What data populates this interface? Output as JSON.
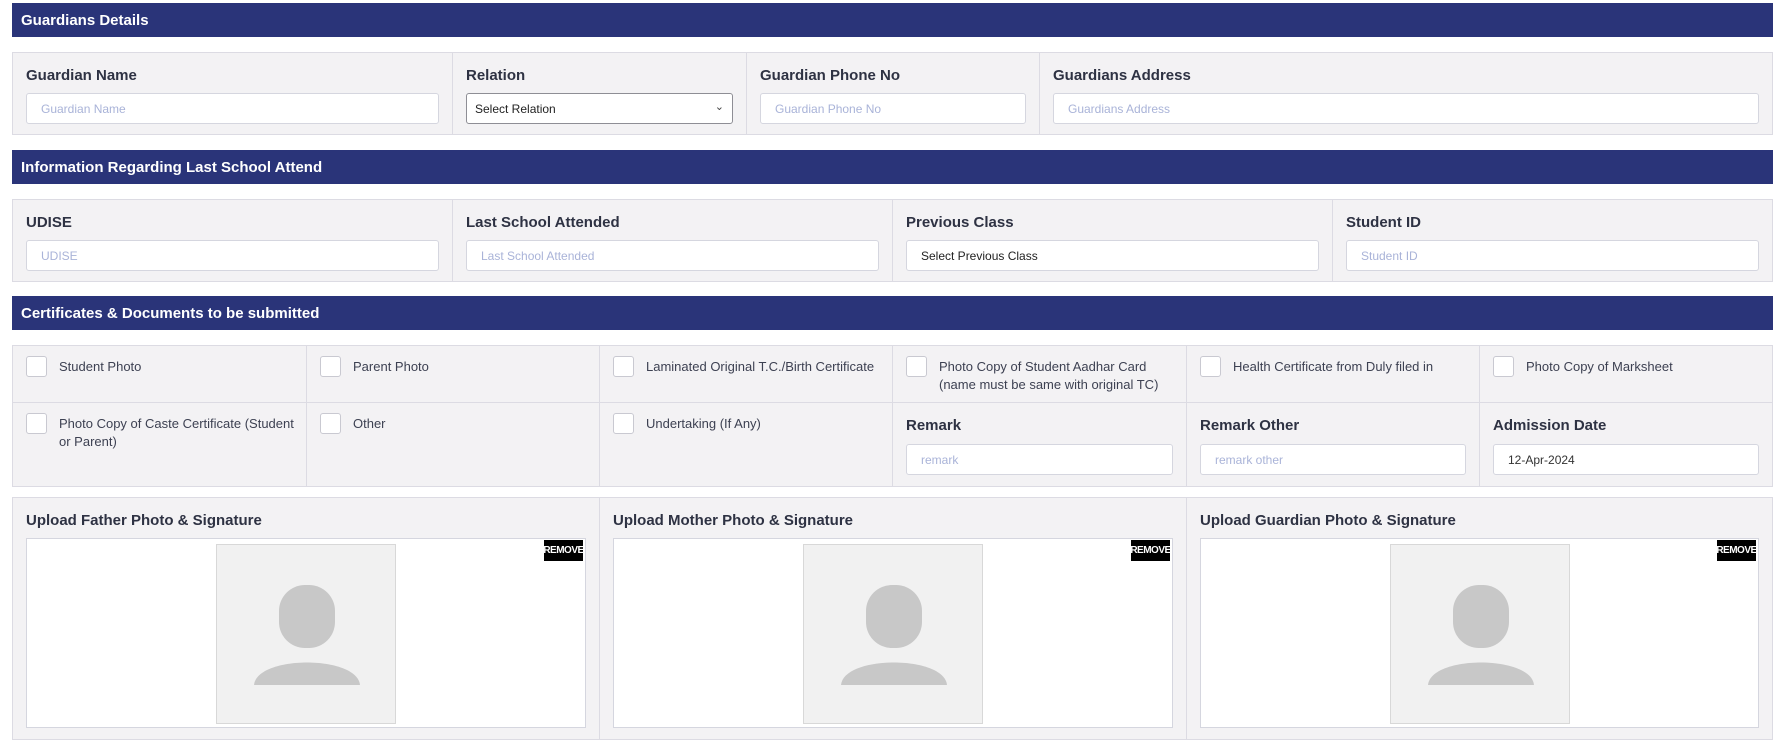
{
  "guardians": {
    "header": "Guardians Details",
    "name_label": "Guardian Name",
    "name_placeholder": "Guardian Name",
    "relation_label": "Relation",
    "relation_value": "Select Relation",
    "phone_label": "Guardian Phone No",
    "phone_placeholder": "Guardian Phone No",
    "address_label": "Guardians Address",
    "address_placeholder": "Guardians Address"
  },
  "last_school": {
    "header": "Information Regarding Last School Attend",
    "udise_label": "UDISE",
    "udise_placeholder": "UDISE",
    "school_label": "Last School Attended",
    "school_placeholder": "Last School Attended",
    "class_label": "Previous Class",
    "class_value": "Select Previous Class",
    "student_id_label": "Student ID",
    "student_id_placeholder": "Student ID"
  },
  "certificates": {
    "header": "Certificates & Documents to be submitted",
    "items": [
      "Student Photo",
      "Parent Photo",
      "Laminated Original T.C./Birth Certificate",
      "Photo Copy of Student Aadhar Card (name must be same with original TC)",
      "Health Certificate from Duly filed in",
      "Photo Copy of Marksheet",
      "Photo Copy of Caste Certificate (Student or Parent)",
      "Other",
      "Undertaking (If Any)"
    ],
    "remark_label": "Remark",
    "remark_placeholder": "remark",
    "remark_other_label": "Remark Other",
    "remark_other_placeholder": "remark other",
    "admission_date_label": "Admission Date",
    "admission_date_value": "12-Apr-2024"
  },
  "uploads": {
    "father_label": "Upload Father Photo & Signature",
    "mother_label": "Upload Mother Photo & Signature",
    "guardian_label": "Upload Guardian Photo & Signature",
    "remove_label": "REMOVE"
  }
}
